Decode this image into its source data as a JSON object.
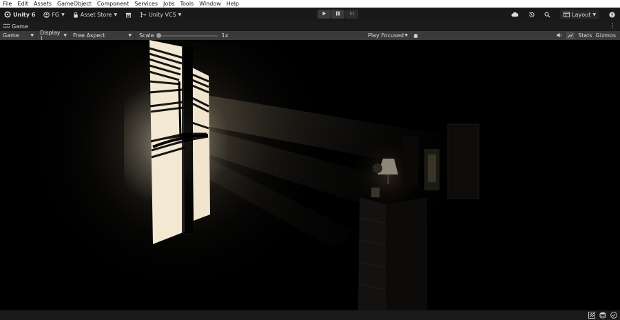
{
  "menu": [
    "File",
    "Edit",
    "Assets",
    "GameObject",
    "Component",
    "Services",
    "Jobs",
    "Tools",
    "Window",
    "Help"
  ],
  "toolbar": {
    "unity_label": "Unity 6",
    "account_label": "FG",
    "asset_store_label": "Asset Store",
    "vcs_label": "Unity VCS",
    "layout_label": "Layout"
  },
  "tab": {
    "label": "Game"
  },
  "gamebar": {
    "mode": "Game",
    "display": "Display 1",
    "aspect": "Free Aspect",
    "scale_label": "Scale",
    "scale_value": "1x",
    "scale_level": 0,
    "play_mode": "Play Focused",
    "stats_label": "Stats",
    "gizmos_label": "Gizmos"
  },
  "icons": {
    "unity": "unity-logo-icon",
    "account": "account-icon",
    "lock": "lock-icon",
    "package": "package-icon",
    "vcs": "version-control-icon",
    "cloud": "cloud-icon",
    "history": "history-icon",
    "search": "search-icon",
    "layout": "layout-icon",
    "help": "help-icon",
    "play": "play-icon",
    "pause": "pause-icon",
    "step": "step-icon"
  },
  "colors": {
    "menubar_bg": "#ffffff",
    "toolbar_bg": "#191919",
    "gamebar_bg": "#3a3a3a",
    "window_light": "#f3e8d2"
  }
}
